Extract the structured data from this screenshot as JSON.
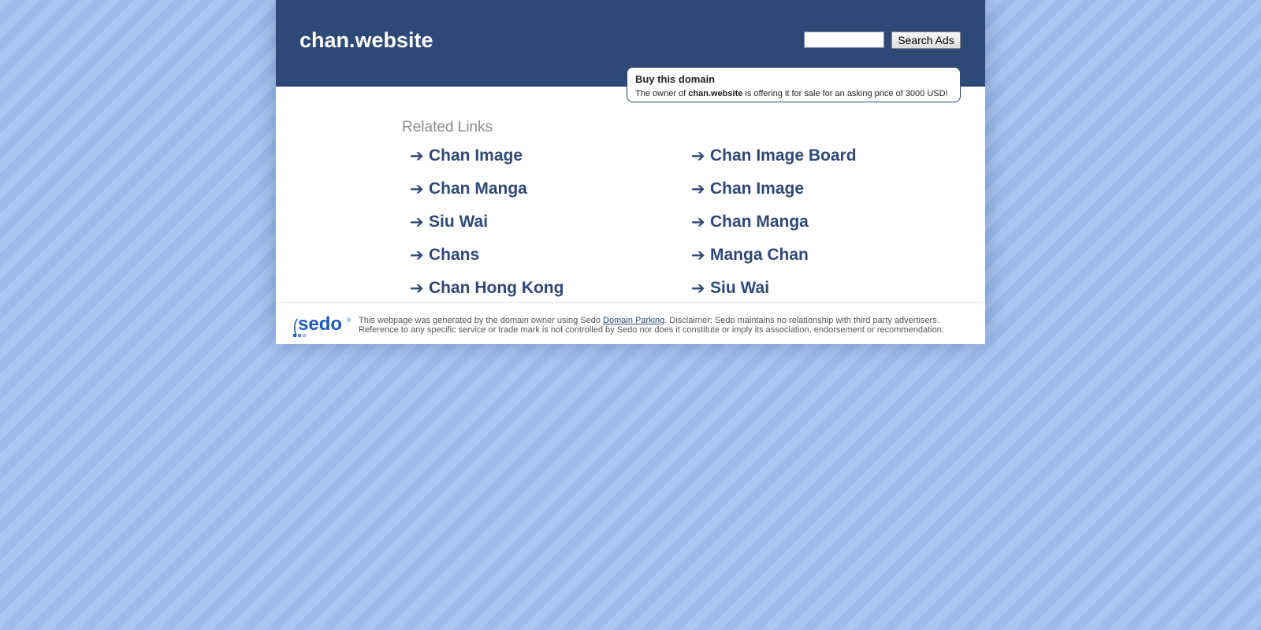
{
  "header": {
    "domain": "chan.website",
    "search_placeholder": "",
    "search_button": "Search Ads"
  },
  "buy_box": {
    "title": "Buy this domain",
    "text_prefix": "The owner of ",
    "domain": "chan.website",
    "text_suffix": " is offering it for sale for an asking price of 3000 USD!"
  },
  "related": {
    "heading": "Related Links",
    "arrow_icon": "arrow-right-icon",
    "links": [
      "Chan Image",
      "Chan Image Board",
      "Chan Manga",
      "Chan Image",
      "Siu Wai",
      "Chan Manga",
      "Chans",
      "Manga Chan",
      "Chan Hong Kong",
      "Siu Wai"
    ]
  },
  "footer": {
    "logo_text": "sedo",
    "text_prefix": "This webpage was generated by the domain owner using Sedo ",
    "link_text": "Domain Parking",
    "text_suffix": ". Disclaimer: Sedo maintains no relationship with third party advertisers. Reference to any specific service or trade mark is not controlled by Sedo nor does it constitute or imply its association, endorsement or recommendation."
  },
  "colors": {
    "header_bg": "#2f4977",
    "link": "#2f4977",
    "page_bg": "#a6c3ef",
    "sedo_blue": "#1f5bb8"
  }
}
